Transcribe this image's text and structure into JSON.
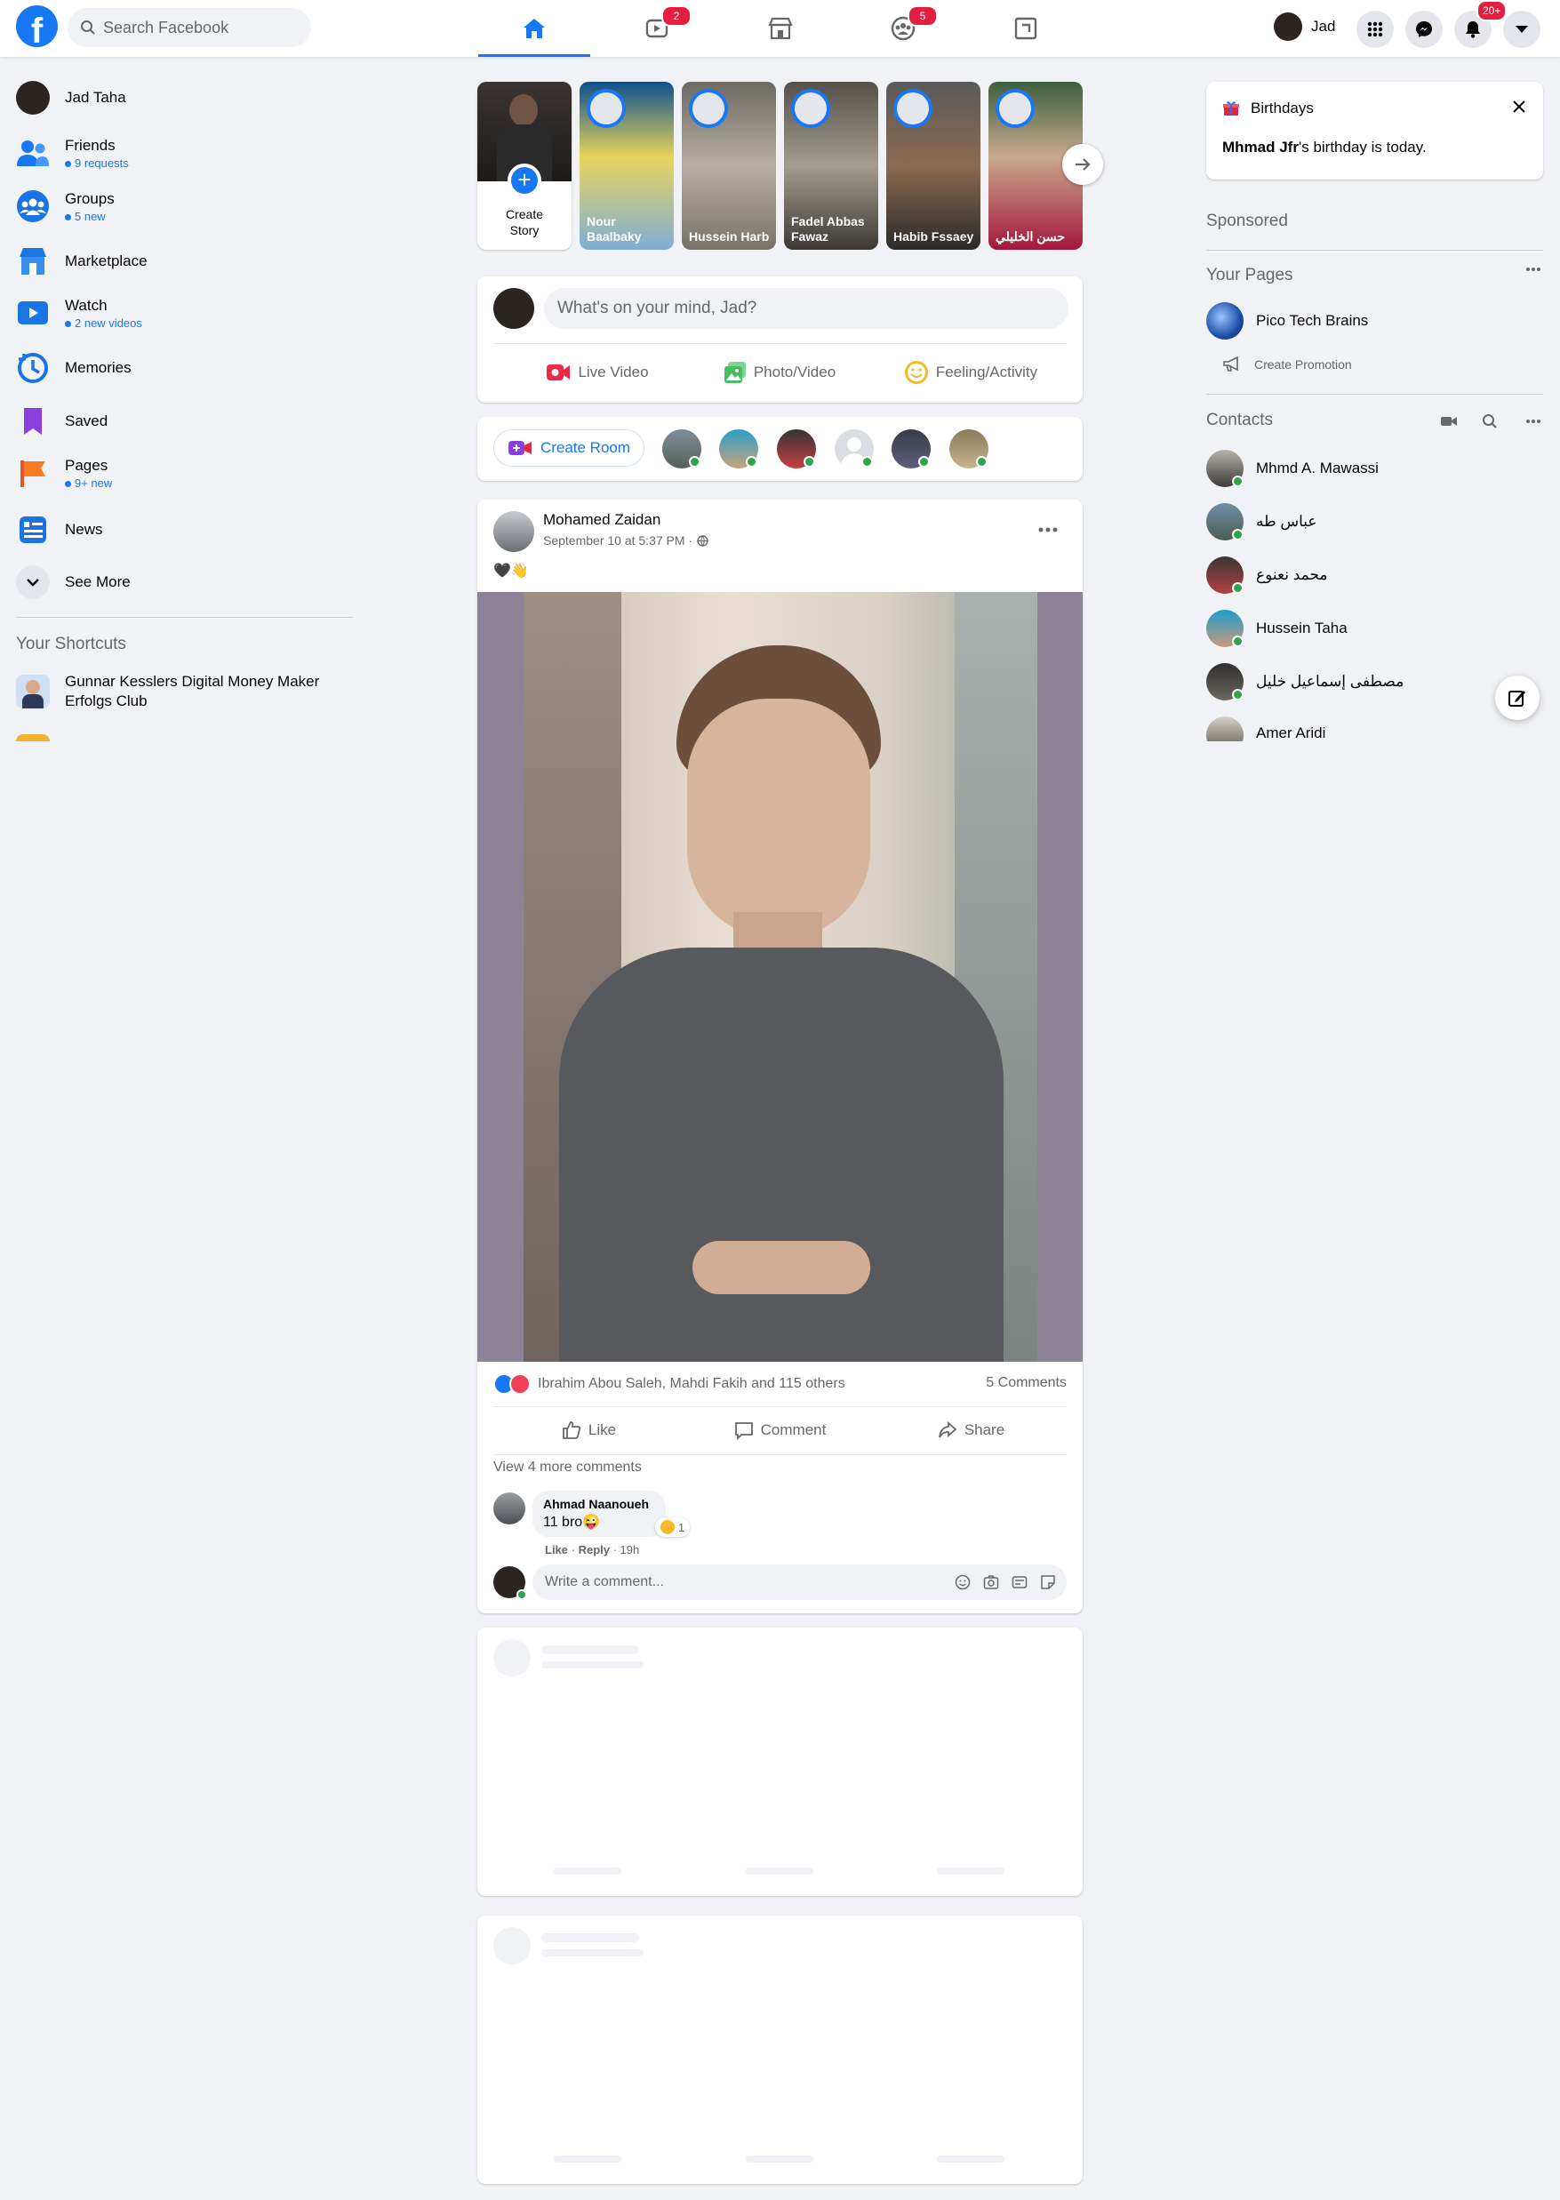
{
  "header": {
    "search_placeholder": "Search Facebook",
    "video_badge": "2",
    "groups_badge": "5",
    "profile_name": "Jad",
    "notif_badge": "20+"
  },
  "sidebar": {
    "profile": "Jad Taha",
    "items": [
      {
        "label": "Friends",
        "sub": "9 requests"
      },
      {
        "label": "Groups",
        "sub": "5 new"
      },
      {
        "label": "Marketplace",
        "sub": ""
      },
      {
        "label": "Watch",
        "sub": "2 new videos"
      },
      {
        "label": "Memories",
        "sub": ""
      },
      {
        "label": "Saved",
        "sub": ""
      },
      {
        "label": "Pages",
        "sub": "9+ new"
      },
      {
        "label": "News",
        "sub": ""
      }
    ],
    "see_more": "See More",
    "shortcuts_title": "Your Shortcuts",
    "shortcut_1": "Gunnar Kesslers Digital Money Maker Erfolgs Club"
  },
  "stories": {
    "create_label": "Create Story",
    "items": [
      "Nour Baalbaky",
      "Hussein Harb",
      "Fadel Abbas Fawaz",
      "Habib Fssaey",
      "حسن الخليلي"
    ]
  },
  "composer": {
    "placeholder": "What's on your mind, Jad?",
    "live": "Live Video",
    "photo": "Photo/Video",
    "feeling": "Feeling/Activity"
  },
  "rooms": {
    "create_room": "Create Room"
  },
  "post": {
    "author": "Mohamed Zaidan",
    "time": "September 10 at 5:37 PM ·",
    "text": "🖤👋",
    "reactions_text": "Ibrahim Abou Saleh, Mahdi Fakih and 115 others",
    "comments_count": "5 Comments",
    "like": "Like",
    "comment": "Comment",
    "share": "Share",
    "view_more": "View 4 more comments",
    "comment_author": "Ahmad Naanoueh",
    "comment_text": "11 bro😜",
    "comment_reaction_count": "1",
    "comment_like": "Like",
    "comment_reply": "Reply",
    "comment_time": "19h",
    "write_placeholder": "Write a comment..."
  },
  "right": {
    "birthdays_title": "Birthdays",
    "birthday_name": "Mhmad Jfr",
    "birthday_text": "'s birthday is today.",
    "sponsored": "Sponsored",
    "your_pages": "Your Pages",
    "page_name": "Pico Tech Brains",
    "create_promotion": "Create Promotion",
    "contacts_title": "Contacts",
    "contacts": [
      "Mhmd A. Mawassi",
      "عباس طه",
      "محمد نعنوع",
      "Hussein Taha",
      "مصطفى إسماعيل خليل",
      "Amer Aridi"
    ]
  },
  "colors": {
    "brand": "#1877f2",
    "badge": "#e41e3f",
    "online": "#31a24c"
  }
}
